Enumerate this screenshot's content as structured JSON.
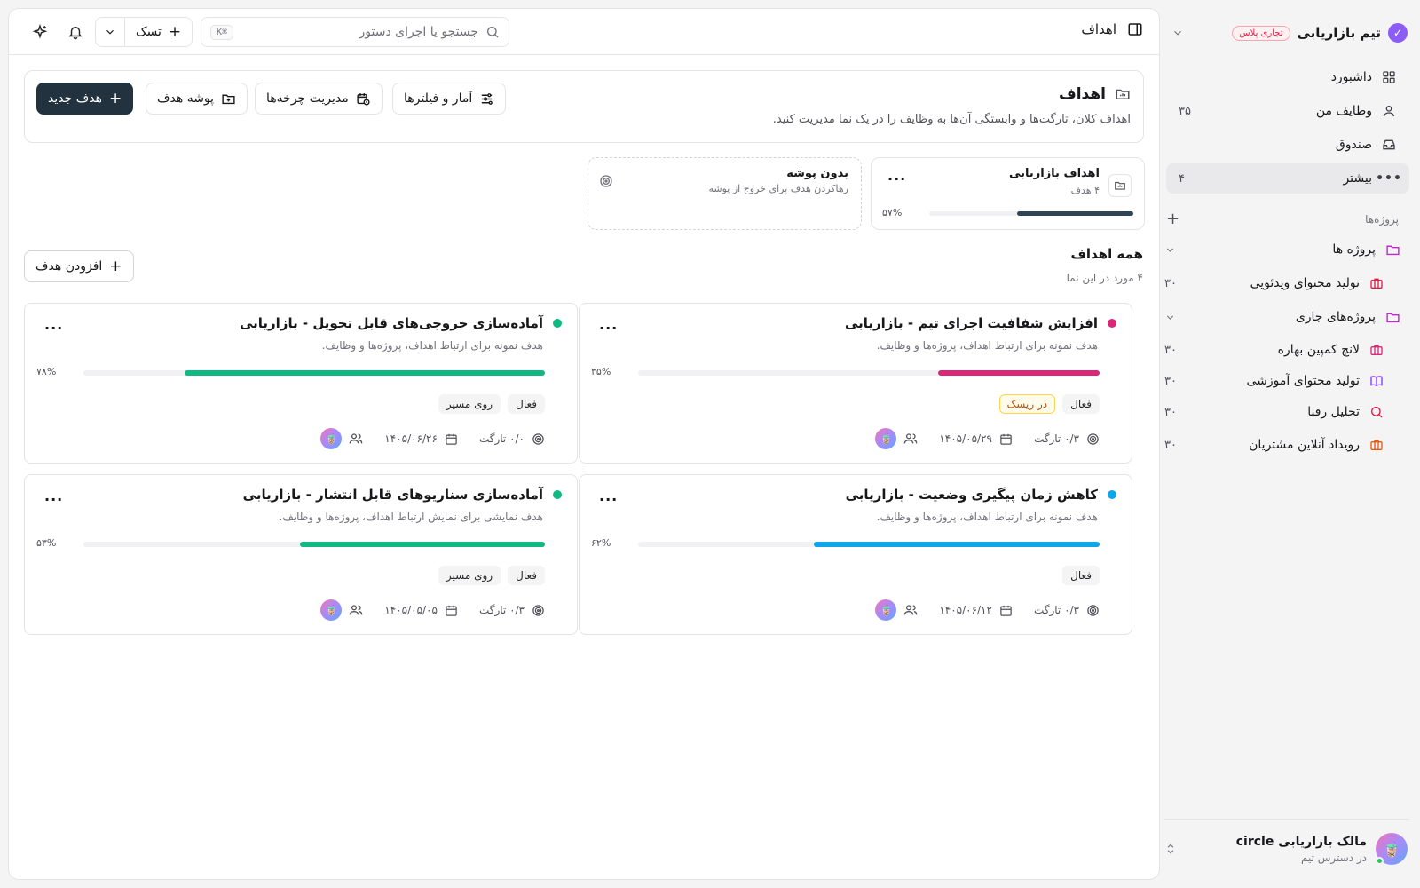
{
  "sidebar": {
    "team_name": "تیم بازاریابی",
    "team_badge": "تجاری پلاس",
    "nav": [
      {
        "label": "داشبورد",
        "icon": "grid-icon",
        "count": ""
      },
      {
        "label": "وظایف من",
        "icon": "user-icon",
        "count": "۳۵"
      },
      {
        "label": "صندوق",
        "icon": "inbox-icon",
        "count": ""
      },
      {
        "label": "بیشتر",
        "icon": "more-icon",
        "count": "۴"
      }
    ],
    "projects_heading": "پروژه‌ها",
    "projects": [
      {
        "label": "پروژه ها",
        "type": "folder",
        "count": ""
      },
      {
        "label": "تولید محتوای ویدئویی",
        "type": "item",
        "count": "۳۰",
        "color": "#e11d48",
        "icon": "briefcase-icon"
      },
      {
        "label": "پروژه‌های جاری",
        "type": "folder",
        "count": ""
      },
      {
        "label": "لانچ کمپین بهاره",
        "type": "item",
        "count": "۳۰",
        "color": "#db2777",
        "icon": "briefcase-icon"
      },
      {
        "label": "تولید محتوای آموزشی",
        "type": "item",
        "count": "۳۰",
        "color": "#7c3aed",
        "icon": "book-icon"
      },
      {
        "label": "تحلیل رقبا",
        "type": "item",
        "count": "۳۰",
        "color": "#e11d48",
        "icon": "search-icon"
      },
      {
        "label": "رویداد آنلاین مشتریان",
        "type": "item",
        "count": "۳۰",
        "color": "#ea580c",
        "icon": "briefcase-icon"
      }
    ],
    "user": {
      "name": "مالک بازاریابی circle",
      "sub": "در دسترس تیم",
      "avatar_emoji": "🧋"
    }
  },
  "topbar": {
    "title": "اهداف",
    "search_placeholder": "جستجو یا اجرای دستور",
    "search_shortcut": "⌘K",
    "task_button": "تسک"
  },
  "header": {
    "title": "اهداف",
    "description": "اهداف کلان، تارگت‌ها و وابستگی آن‌ها به وظایف را در یک نما مدیریت کنید.",
    "buttons": {
      "stats": "آمار و فیلترها",
      "cycles": "مدیریت چرخه‌ها",
      "folder": "پوشه هدف",
      "new_goal": "هدف جدید"
    }
  },
  "folders": [
    {
      "name": "اهداف بازاریابی",
      "count": "۴ هدف",
      "percent_label": "۵۷%",
      "progress": 0.57
    }
  ],
  "no_folder": {
    "name": "بدون پوشه",
    "sub": "رهاکردن هدف برای خروج از پوشه"
  },
  "all_goals": {
    "title": "همه اهداف",
    "sub": "۴ مورد در این نما",
    "add_button": "افزودن هدف"
  },
  "goals": [
    {
      "title": "افزایش شفافیت اجرای تیم - بازاریابی",
      "desc": "هدف نمونه برای ارتباط اهداف، پروژه‌ها و وظایف.",
      "color": "#db2777",
      "percent_label": "۳۵%",
      "progress": 0.35,
      "badges": [
        "فعال",
        "در ریسک"
      ],
      "targets": "۰/۳ تارگت",
      "date": "۱۴۰۵/۰۵/۲۹"
    },
    {
      "title": "آماده‌سازی خروجی‌های قابل تحویل - بازاریابی",
      "desc": "هدف نمونه برای ارتباط اهداف، پروژه‌ها و وظایف.",
      "color": "#10b981",
      "percent_label": "۷۸%",
      "progress": 0.78,
      "badges": [
        "فعال",
        "روی مسیر"
      ],
      "targets": "۰/۰ تارگت",
      "date": "۱۴۰۵/۰۶/۲۶"
    },
    {
      "title": "کاهش زمان پیگیری وضعیت - بازاریابی",
      "desc": "هدف نمونه برای ارتباط اهداف، پروژه‌ها و وظایف.",
      "color": "#0ea5e9",
      "percent_label": "۶۲%",
      "progress": 0.62,
      "badges": [
        "فعال"
      ],
      "targets": "۰/۳ تارگت",
      "date": "۱۴۰۵/۰۶/۱۲"
    },
    {
      "title": "آماده‌سازی سناریوهای قابل انتشار - بازاریابی",
      "desc": "هدف نمایشی برای نمایش ارتباط اهداف، پروژه‌ها و وظایف.",
      "color": "#10b981",
      "percent_label": "۵۳%",
      "progress": 0.53,
      "badges": [
        "فعال",
        "روی مسیر"
      ],
      "targets": "۰/۳ تارگت",
      "date": "۱۴۰۵/۰۵/۰۵"
    }
  ],
  "colors": {
    "primary": "#22333f",
    "brand": "#8b5cf6"
  }
}
